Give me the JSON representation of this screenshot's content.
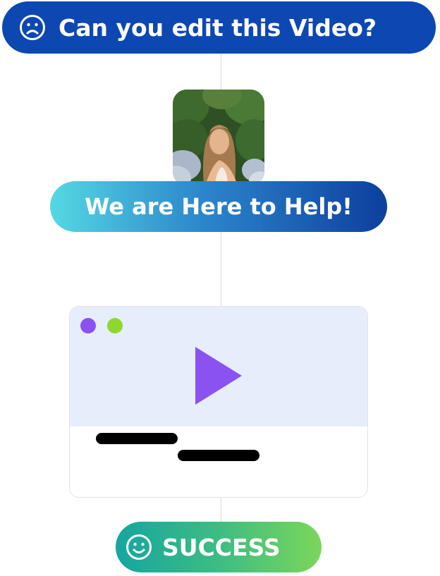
{
  "question_pill": {
    "text": "Can you edit this Video?",
    "icon": "sad-face-icon",
    "color": "#0d47b2"
  },
  "avatar": {
    "icon": "person-photo"
  },
  "help_pill": {
    "text": "We are Here to Help!",
    "gradient": [
      "#55d8e3",
      "#2c86cc",
      "#0d3f9e"
    ]
  },
  "video_card": {
    "dot_colors": [
      "#8b52f2",
      "#8fd72e"
    ],
    "play_icon": "play-icon",
    "play_color": "#8b52f2",
    "screen_color": "#e6eefb"
  },
  "success_pill": {
    "text": "SUCCESS",
    "icon": "smile-face-icon",
    "gradient": [
      "#14a6a1",
      "#3dbd83",
      "#7bd65a"
    ]
  }
}
